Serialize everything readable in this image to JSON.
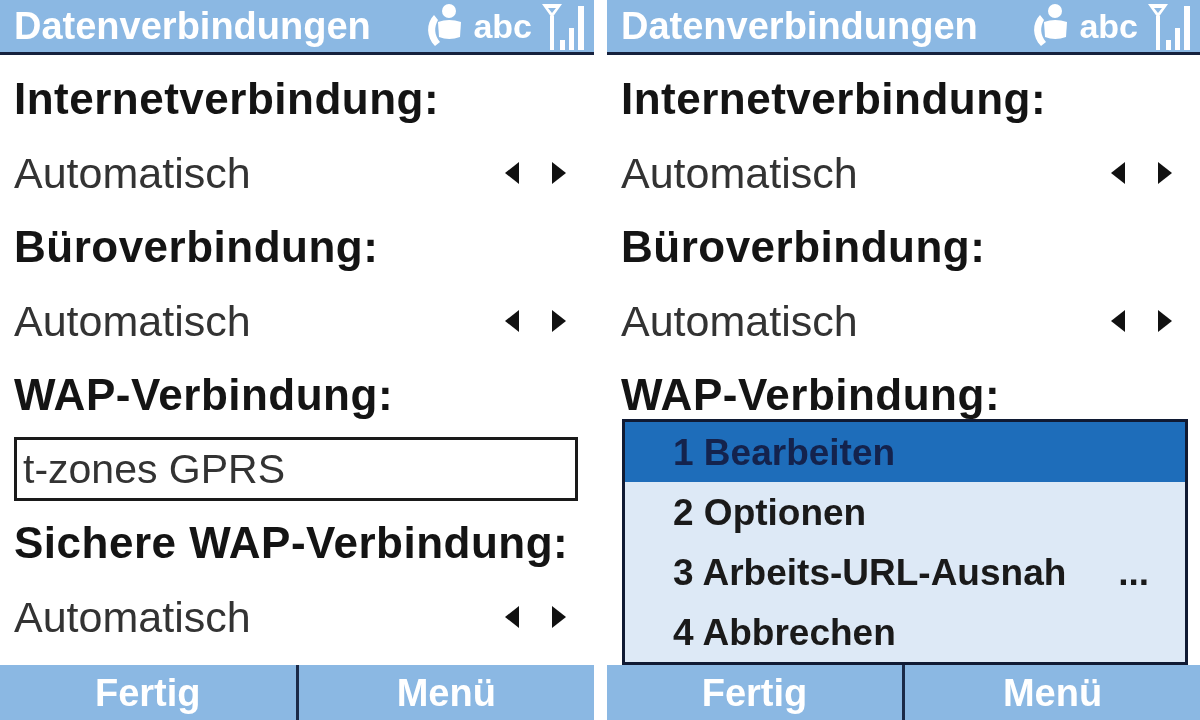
{
  "screens": [
    {
      "title": "Datenverbindungen",
      "status": {
        "input_mode": "abc"
      },
      "settings": [
        {
          "label": "Internetverbindung:",
          "kind": "picker",
          "value": "Automatisch"
        },
        {
          "label": "Büroverbindung:",
          "kind": "picker",
          "value": "Automatisch"
        },
        {
          "label": "WAP-Verbindung:",
          "kind": "field",
          "value": "t-zones GPRS"
        },
        {
          "label": "Sichere WAP-Verbindung:",
          "kind": "picker",
          "value": "Automatisch"
        }
      ],
      "softkeys": [
        "Fertig",
        "Menü"
      ]
    },
    {
      "title": "Datenverbindungen",
      "status": {
        "input_mode": "abc"
      },
      "settings": [
        {
          "label": "Internetverbindung:",
          "kind": "picker",
          "value": "Automatisch"
        },
        {
          "label": "Büroverbindung:",
          "kind": "picker",
          "value": "Automatisch"
        },
        {
          "label": "WAP-Verbindung:",
          "kind": "label"
        }
      ],
      "menu": {
        "items": [
          {
            "label": "1 Bearbeiten",
            "selected": true
          },
          {
            "label": "2 Optionen",
            "selected": false
          },
          {
            "label": "3 Arbeits-URL-Ausnah",
            "more": "...",
            "selected": false
          },
          {
            "label": "4 Abbrechen",
            "selected": false
          }
        ]
      },
      "softkeys": [
        "Fertig",
        "Menü"
      ]
    }
  ]
}
